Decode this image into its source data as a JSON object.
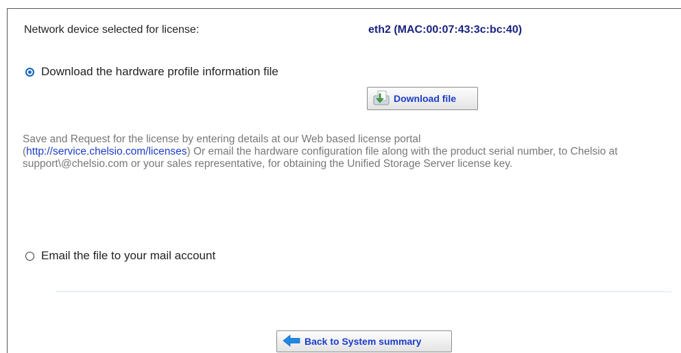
{
  "license": {
    "device_label": "Network device selected for license:",
    "device_value": "eth2 (MAC:00:07:43:3c:bc:40)"
  },
  "options": {
    "download": {
      "label": "Download the hardware profile information file",
      "checked": true
    },
    "email": {
      "label": "Email the file to your mail account",
      "checked": false
    }
  },
  "buttons": {
    "download_file": "Download file",
    "back": "Back to System summary"
  },
  "info": {
    "part1": "Save and Request for the license by entering details at our Web based license portal",
    "link_open": "(",
    "link": "http://service.chelsio.com/licenses",
    "link_close": ")",
    "part2": " Or email the hardware configuration file along with the product serial number, to Chelsio at support\\@chelsio.com or your sales representative, for obtaining the Unified Storage Server license key."
  },
  "icons": {
    "download": "download-arrow-icon",
    "back": "back-arrow-icon"
  },
  "colors": {
    "device_value": "#1a237e",
    "link": "#1a3cc8",
    "radio_checked": "#1565c0",
    "info_text": "#777777"
  }
}
